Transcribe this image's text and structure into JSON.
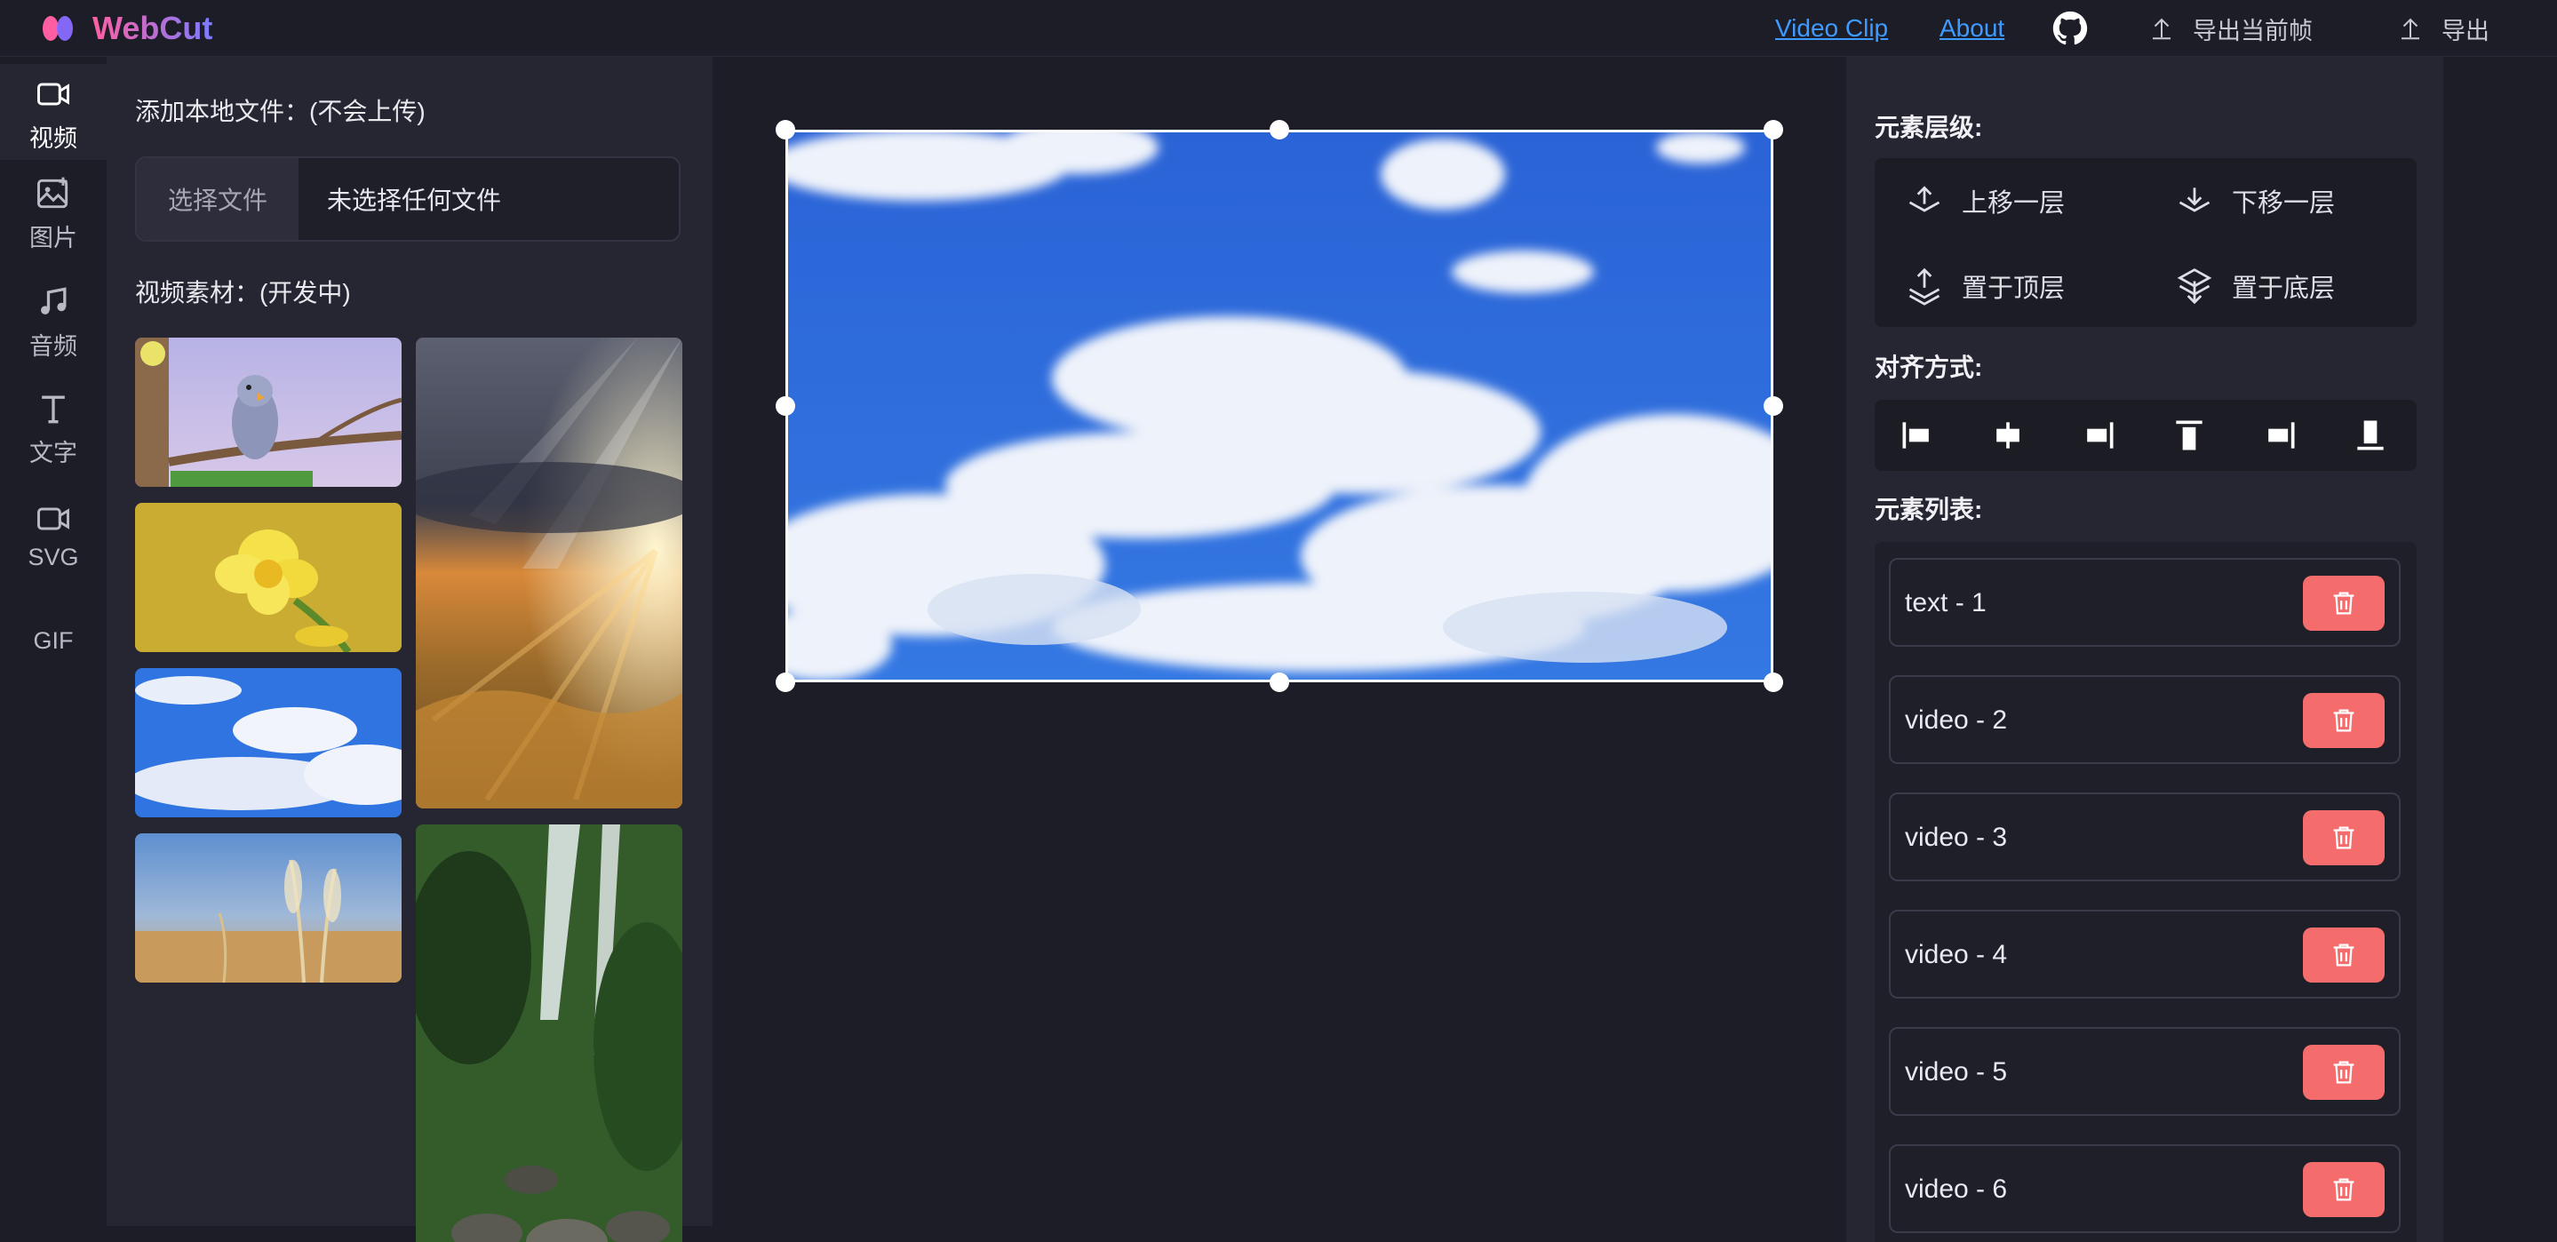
{
  "header": {
    "app_name": "WebCut",
    "links": {
      "video_clip": "Video Clip",
      "about": "About"
    },
    "export_frame_label": "导出当前帧",
    "export_label": "导出",
    "icons": {
      "logo": "webcut-logo",
      "github": "github-icon",
      "upload": "upload-icon"
    },
    "accent_colors": {
      "link": "#3d9bff",
      "logo_pink": "#ff5fa2",
      "logo_purple": "#7c7cff"
    }
  },
  "sidebar": {
    "tabs": [
      {
        "label": "视频",
        "icon": "video-camera-icon",
        "active": true
      },
      {
        "label": "图片",
        "icon": "image-add-icon",
        "active": false
      },
      {
        "label": "音频",
        "icon": "music-note-icon",
        "active": false
      },
      {
        "label": "文字",
        "icon": "text-icon",
        "active": false
      },
      {
        "label": "SVG",
        "icon": "video-camera-icon",
        "active": false
      },
      {
        "label": "GIF",
        "icon": "",
        "active": false
      }
    ]
  },
  "resources": {
    "local_title": "添加本地文件：(不会上传)",
    "file_button": "选择文件",
    "file_status": "未选择任何文件",
    "materials_title": "视频素材：(开发中)",
    "thumbnails": [
      "bird-on-branch",
      "yellow-daffodil",
      "blue-sky-clouds",
      "reeds-in-wind",
      "storm-sunset-landscape",
      "forest-waterfall"
    ]
  },
  "props": {
    "layer_title": "元素层级:",
    "layer_actions": {
      "up": "上移一层",
      "down": "下移一层",
      "top": "置于顶层",
      "bottom": "置于底层"
    },
    "align_title": "对齐方式:",
    "align_icons": [
      "align-left-icon",
      "align-center-horizontal-icon",
      "align-right-icon",
      "align-top-icon",
      "align-middle-vertical-icon",
      "align-bottom-icon"
    ],
    "list_title": "元素列表:",
    "elements": [
      "text - 1",
      "video - 2",
      "video - 3",
      "video - 4",
      "video - 5",
      "video - 6"
    ],
    "delete_color": "#f56c6c"
  }
}
